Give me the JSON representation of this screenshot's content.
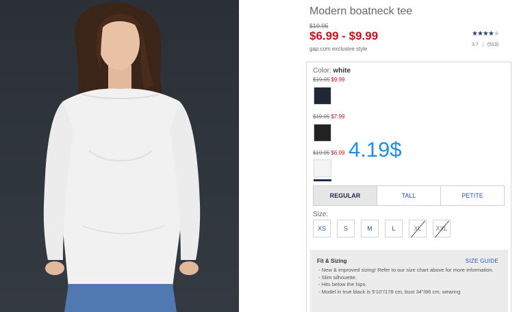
{
  "product": {
    "title": "Modern boatneck tee",
    "original_price": "$19.95",
    "sale_price": "$6.99 - $9.99",
    "exclusive": "gap.com exclusive style"
  },
  "rating": {
    "stars_glyph": "★★★★",
    "empty_glyph": "★",
    "score": "3.7",
    "reviews": "(513)"
  },
  "color": {
    "label": "Color:",
    "selected": "white",
    "swatches": [
      {
        "name": "navy",
        "old_price": "$19.95",
        "new_price": "$9.99",
        "hex": "#1f2733"
      },
      {
        "name": "black",
        "old_price": "$19.95",
        "new_price": "$7.99",
        "hex": "#222222"
      },
      {
        "name": "white",
        "old_price": "$19.95",
        "new_price": "$6.99",
        "hex": "#f4f4f4"
      }
    ]
  },
  "overlay_price": "4.19$",
  "fit": {
    "tabs": [
      "REGULAR",
      "TALL",
      "PETITE"
    ],
    "active": "REGULAR"
  },
  "size": {
    "label": "Size:",
    "options": [
      "XS",
      "S",
      "M",
      "L",
      "XL",
      "XXL"
    ],
    "unavailable": [
      "XL",
      "XXL"
    ]
  },
  "fit_sizing": {
    "title": "Fit & Sizing",
    "size_guide": "SIZE GUIDE",
    "bullets": [
      "New & improved sizing! Refer to our size chart above for more information.",
      "Slim silhouette.",
      "Hits below the hips.",
      "Model in true black is 5'10\"/178 cm, bust 34\"/86 cm, wearing"
    ]
  },
  "colors": {
    "sale_red": "#c7111b",
    "link_blue": "#2456a5",
    "overlay_blue": "#1f8fe6",
    "photo_bg": "#2f353c"
  }
}
